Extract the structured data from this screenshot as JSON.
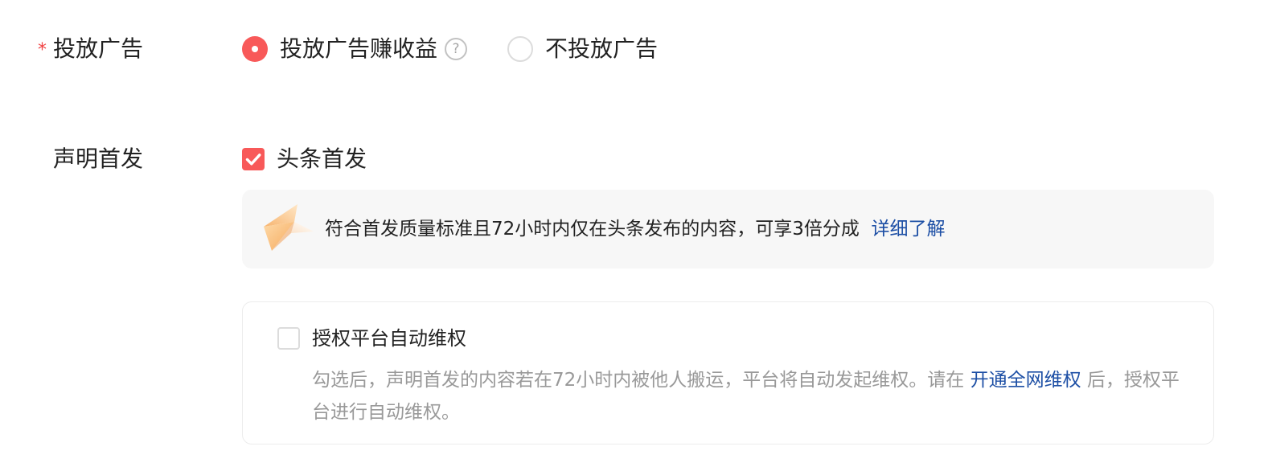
{
  "ad_row": {
    "required_mark": "*",
    "label": "投放广告",
    "options": [
      {
        "label": "投放广告赚收益",
        "selected": true
      },
      {
        "label": "不投放广告",
        "selected": false
      }
    ],
    "help_glyph": "?",
    "help_icon": "question-circle-icon"
  },
  "first_publish_row": {
    "label": "声明首发",
    "checkbox_label": "头条首发",
    "checked": true,
    "info": {
      "text": "符合首发质量标准且72小时内仅在头条发布的内容，可享3倍分成",
      "link": "详细了解",
      "illustration": "origami-star-illustration"
    }
  },
  "auto_rights": {
    "checkbox_label": "授权平台自动维权",
    "checked": false,
    "desc_before": "勾选后，声明首发的内容若在72小时内被他人搬运，平台将自动发起维权。请在 ",
    "desc_link": "开通全网维权",
    "desc_after": " 后，授权平台进行自动维权。"
  },
  "colors": {
    "accent": "#f85959",
    "link": "#1d4fa5",
    "required": "#f04142",
    "muted_text": "#999999"
  }
}
